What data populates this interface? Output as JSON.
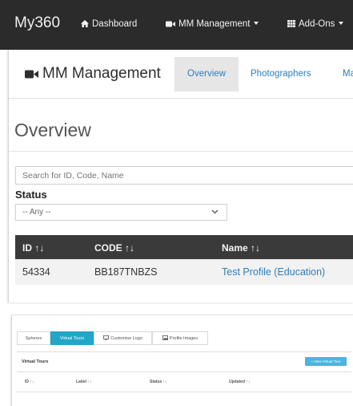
{
  "navbar": {
    "brand": "My360",
    "items": [
      {
        "label": "Dashboard",
        "icon": "home-icon"
      },
      {
        "label": "MM Management",
        "icon": "video-camera-icon",
        "has_caret": true
      },
      {
        "label": "Add-Ons",
        "icon": "grid-icon",
        "has_caret": true
      }
    ]
  },
  "sub_nav": {
    "title": "MM Management",
    "tabs": [
      "Overview",
      "Photographers",
      "Ma"
    ],
    "active_tab": "Overview"
  },
  "overview": {
    "page_title": "Overview",
    "search_placeholder": "Search for ID, Code, Name",
    "status_label": "Status",
    "status_value": "-- Any --",
    "columns": [
      "ID ↑↓",
      "CODE ↑↓",
      "Name ↑↓"
    ],
    "rows": [
      {
        "id": "54334",
        "code": "BB187TNBZS",
        "name": "Test Profile (Education)"
      }
    ]
  },
  "tours_panel": {
    "tabs": [
      {
        "label": "Spheres",
        "active": false
      },
      {
        "label": "Virtual Tours",
        "active": true
      },
      {
        "label": "Customise Logo",
        "icon": "monitor-icon",
        "active": false
      },
      {
        "label": "Profile Images",
        "icon": "image-icon",
        "active": false
      }
    ],
    "heading": "Virtual Tours",
    "new_button": "+ New Virtual Tour",
    "columns": [
      "ID ↑↓",
      "Label ↑↓",
      "Status ↑↓",
      "Updated ↑↓"
    ]
  },
  "colors": {
    "navbar_bg": "#2b2b2b",
    "link": "#2a7fc1",
    "table_header_bg": "#3a3a3a",
    "active_tab_bg": "#22a6c8",
    "new_button_bg": "#4fb2e0"
  }
}
